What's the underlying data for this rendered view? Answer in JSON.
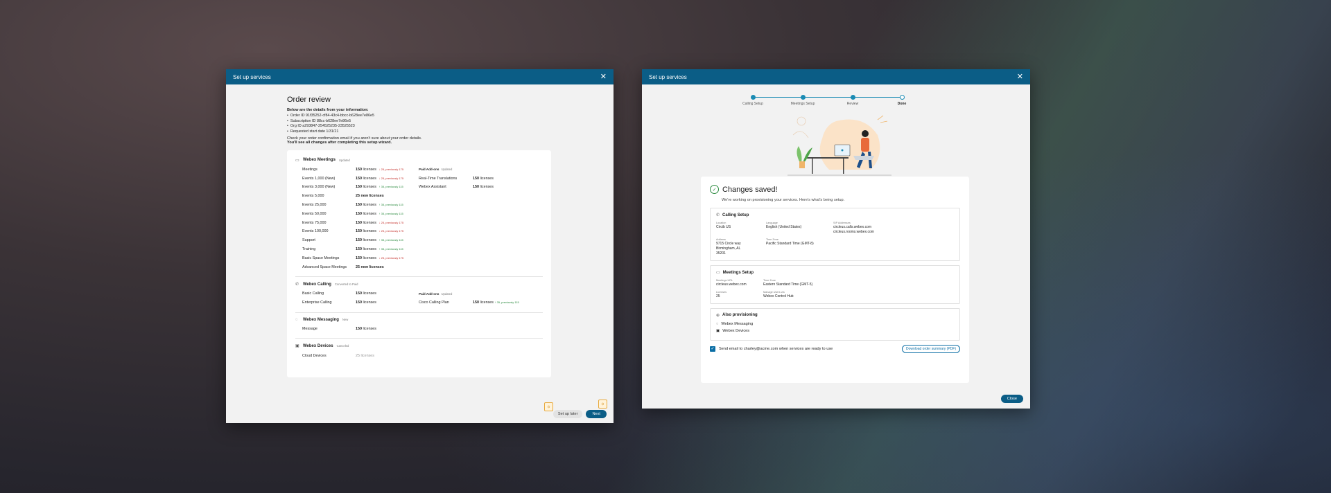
{
  "left": {
    "title": "Set up services",
    "close": "✕",
    "heading": "Order review",
    "intro": "Below are the details from your information:",
    "details": [
      "Order ID 91f35252-cf84-43c4-bbcc-b628ee7e86e5",
      "Subscription ID 88cc-b628ee7e86e5",
      "Org ID a293847-254525235-23525523",
      "Requested start date 1/31/21"
    ],
    "note": "Check your order confirmation email if you aren't sure about your order details.",
    "note_bold": "You'll see all changes after completing this setup wizard.",
    "meetings": {
      "title": "Webex Meetings",
      "tag": "Updated",
      "rows": [
        {
          "name": "Meetings",
          "lic": "150",
          "unit": "licenses",
          "chg": "↓ 25, previously 175",
          "dir": "down"
        },
        {
          "name": "Events 1,000 (New)",
          "lic": "150",
          "unit": "licenses",
          "chg": "↓ 25, previously 175",
          "dir": "down"
        },
        {
          "name": "Events 3,000 (New)",
          "lic": "150",
          "unit": "licenses",
          "chg": "↑ 35, previously 115",
          "dir": "up"
        },
        {
          "name": "Events 5,000",
          "lic": "25 new licenses",
          "unit": "",
          "chg": "",
          "dir": ""
        },
        {
          "name": "Events 25,000",
          "lic": "150",
          "unit": "licenses",
          "chg": "↑ 35, previously 115",
          "dir": "up"
        },
        {
          "name": "Events 50,000",
          "lic": "150",
          "unit": "licenses",
          "chg": "↑ 35, previously 115",
          "dir": "up"
        },
        {
          "name": "Events 75,000",
          "lic": "150",
          "unit": "licenses",
          "chg": "↓ 25, previously 175",
          "dir": "down"
        },
        {
          "name": "Events 100,000",
          "lic": "150",
          "unit": "licenses",
          "chg": "↓ 25, previously 175",
          "dir": "down"
        },
        {
          "name": "Support",
          "lic": "150",
          "unit": "licenses",
          "chg": "↑ 35, previously 115",
          "dir": "up"
        },
        {
          "name": "Training",
          "lic": "150",
          "unit": "licenses",
          "chg": "↑ 35, previously 115",
          "dir": "up"
        },
        {
          "name": "Basic Space Meetings",
          "lic": "150",
          "unit": "licenses",
          "chg": "↓ 25, previously 175",
          "dir": "down"
        },
        {
          "name": "Advanced Space Meetings",
          "lic": "25 new licenses",
          "unit": "",
          "chg": "",
          "dir": ""
        }
      ],
      "addons_head": "Paid Add-ons",
      "addons_tag": "Updated",
      "addons": [
        {
          "name": "Real-Time Translations",
          "lic": "150",
          "unit": "licenses"
        },
        {
          "name": "Webex Assistant",
          "lic": "150",
          "unit": "licenses"
        }
      ]
    },
    "calling": {
      "title": "Webex Calling",
      "tag": "Converted to Paid",
      "rows": [
        {
          "name": "Basic Calling",
          "lic": "150",
          "unit": "licenses"
        },
        {
          "name": "Enterprise Calling",
          "lic": "150",
          "unit": "licenses"
        }
      ],
      "addons_head": "Paid Add-ons",
      "addons_tag": "Updated",
      "addon": {
        "name": "Cisco Calling Plan",
        "lic": "150",
        "unit": "licenses",
        "chg": "↑ 35, previously 115"
      }
    },
    "messaging": {
      "title": "Webex Messaging",
      "tag": "New",
      "row": {
        "name": "Message",
        "lic": "150",
        "unit": "licenses"
      }
    },
    "devices": {
      "title": "Webex Devices",
      "tag": "Canceled",
      "row": {
        "name": "Cloud Devices",
        "lic": "25 licenses"
      }
    },
    "btn_later": "Set up later",
    "btn_next": "Next"
  },
  "right": {
    "title": "Set up services",
    "close": "✕",
    "steps": [
      "Calling Setup",
      "Meetings Setup",
      "Review",
      "Done"
    ],
    "heading": "Changes saved!",
    "sub": "We're working on provisioning your services. Here's what's being setup.",
    "calling": {
      "title": "Calling Setup",
      "location_lb": "Location",
      "location": "Circib US",
      "language_lb": "Language",
      "language": "English (United States)",
      "sip_lb": "SIP Addresses",
      "sip1": "circleus.calls.webex.com",
      "sip2": "circleus.rooms.webex.com",
      "address_lb": "Address",
      "address1": "9715 Circle way",
      "address2": "Birmingham, AL",
      "address3": "35201",
      "tz_lb": "Time Zone",
      "tz": "Pacific Standard Time (GMT-8)"
    },
    "meetings": {
      "title": "Meetings Setup",
      "url_lb": "Meetings URL",
      "url": "circleus.webex.com",
      "tz_lb": "Time Zone",
      "tz": "Eastern Standard Time (GMT-5)",
      "lic_lb": "Licenses",
      "lic": "25",
      "manage_lb": "Manage Users via",
      "manage": "Webex Control Hub"
    },
    "also": {
      "title": "Also provisioning",
      "items": [
        "Webex Messaging",
        "Webex Devices"
      ]
    },
    "email": "Send email to charley@acme.com when services are ready to use",
    "download": "Download order summary (PDF)",
    "btn_close": "Close"
  }
}
